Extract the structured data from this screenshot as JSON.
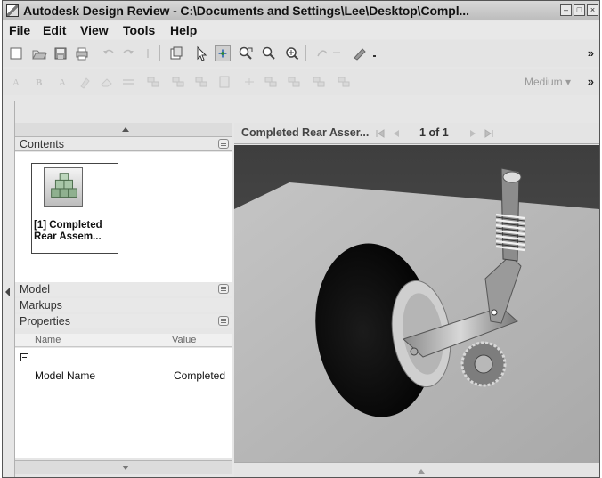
{
  "window": {
    "title": "Autodesk Design Review - C:\\Documents and Settings\\Lee\\Desktop\\Compl...",
    "controls": [
      "minimize",
      "maximize",
      "close"
    ]
  },
  "menu": {
    "items": [
      {
        "label": "File",
        "accel": "F",
        "rest": "ile"
      },
      {
        "label": "Edit",
        "accel": "E",
        "rest": "dit"
      },
      {
        "label": "View",
        "accel": "V",
        "rest": "iew"
      },
      {
        "label": "Tools",
        "accel": "T",
        "rest": "ools"
      },
      {
        "label": "Help",
        "accel": "H",
        "rest": "elp"
      }
    ]
  },
  "toolbar1": {
    "icons": [
      "new-icon",
      "open-icon",
      "save-icon",
      "print-icon",
      "undo-icon",
      "redo-icon",
      "redo-extra-icon",
      "publish-icon",
      "select-arrow-icon",
      "pan-icon",
      "zoom-rectangle-icon",
      "zoom-icon",
      "zoom-fit-icon",
      "orbit-icon",
      "markup-tool-icon"
    ],
    "more": "»"
  },
  "toolbar2": {
    "style_value": "Medium",
    "more": "»"
  },
  "left_panel": {
    "contents_label": "Contents",
    "thumbnail_label_line1": "[1] Completed",
    "thumbnail_label_line2": "Rear Assem...",
    "model_label": "Model",
    "markups_label": "Markups",
    "properties_label": "Properties",
    "col_name": "Name",
    "col_value": "Value",
    "property": {
      "name": "Model Name",
      "value": "Completed"
    }
  },
  "viewer": {
    "sheet_title": "Completed Rear Asser...",
    "page_current": "1",
    "page_of": "of",
    "page_total": "1"
  },
  "colors": {
    "floor": "#b7b7b7",
    "background": "#4a4a4a",
    "tire": "#080808",
    "spring": "#d0d0d0"
  }
}
